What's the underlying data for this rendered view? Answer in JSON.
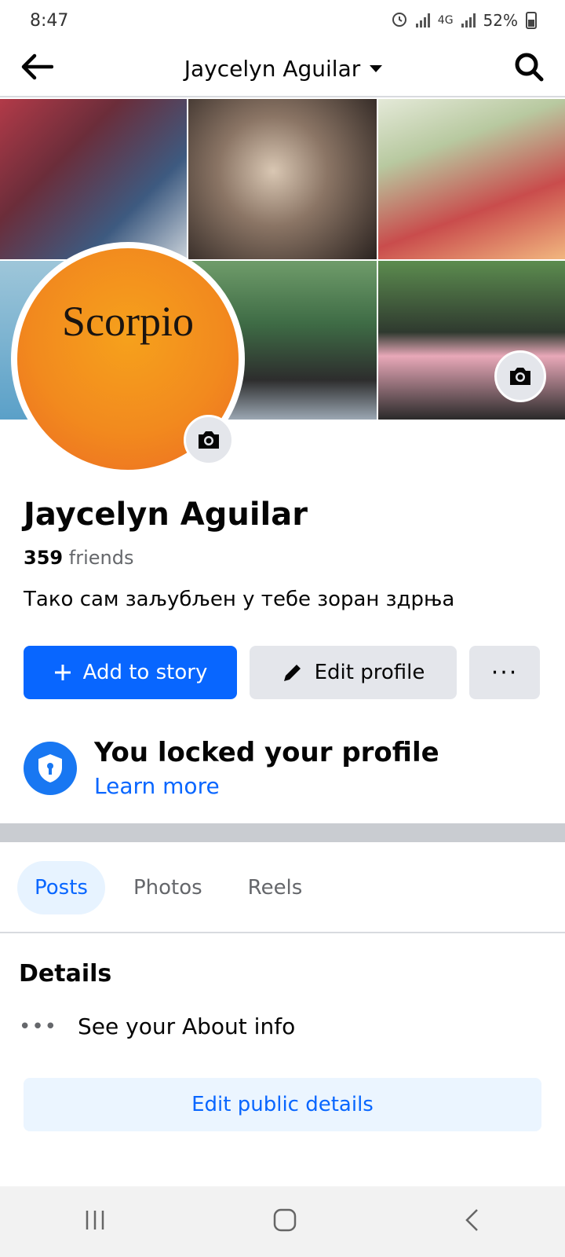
{
  "status_bar": {
    "time": "8:47",
    "battery": "52%",
    "network": "4G"
  },
  "header": {
    "title": "Jaycelyn Aguilar"
  },
  "avatar": {
    "text": "Scorpio"
  },
  "profile": {
    "name": "Jaycelyn Aguilar",
    "friends_count": "359",
    "friends_label": "friends",
    "bio": "Тако сам заљубљен у тебе зоран здрња"
  },
  "actions": {
    "add_story": "Add to story",
    "edit_profile": "Edit profile",
    "more": "···"
  },
  "locked": {
    "title": "You locked your profile",
    "link": "Learn more"
  },
  "tabs": [
    {
      "label": "Posts",
      "active": true
    },
    {
      "label": "Photos",
      "active": false
    },
    {
      "label": "Reels",
      "active": false
    }
  ],
  "details": {
    "title": "Details",
    "about": "See your About info",
    "edit_button": "Edit public details"
  },
  "colors": {
    "accent": "#0866ff",
    "divider": "#c9ccd1"
  }
}
